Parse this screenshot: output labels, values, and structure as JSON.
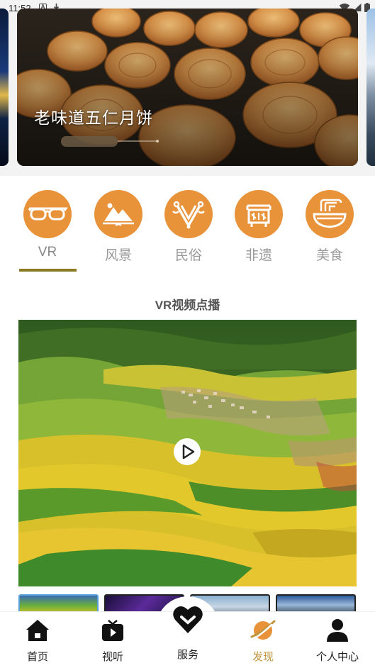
{
  "status_bar": {
    "time": "11:52",
    "icons": [
      "a-notification-icon",
      "download-icon",
      "wifi-icon",
      "cellular-icon",
      "battery-icon"
    ]
  },
  "banner": {
    "title": "老味道五仁月饼",
    "image": "mooncake-photo"
  },
  "categories": [
    {
      "label": "VR",
      "icon": "vr-glasses-icon",
      "active": true
    },
    {
      "label": "风景",
      "icon": "mountain-icon",
      "active": false
    },
    {
      "label": "民俗",
      "icon": "folk-ornament-icon",
      "active": false
    },
    {
      "label": "非遗",
      "icon": "heritage-icon",
      "active": false
    },
    {
      "label": "美食",
      "icon": "food-bowl-icon",
      "active": false
    }
  ],
  "section": {
    "title": "VR视频点播"
  },
  "video": {
    "image": "rapeseed-field-landscape",
    "play_icon": "play-icon"
  },
  "thumbnails": [
    "thumb-landscape",
    "thumb-night-lights",
    "thumb-city-towers",
    "thumb-skyline"
  ],
  "bottom_nav": [
    {
      "label": "首页",
      "icon": "home-icon",
      "active": false
    },
    {
      "label": "视听",
      "icon": "tv-play-icon",
      "active": false
    },
    {
      "label": "服务",
      "icon": "heart-icon",
      "active": false
    },
    {
      "label": "发现",
      "icon": "planet-icon",
      "active": true
    },
    {
      "label": "个人中心",
      "icon": "user-icon",
      "active": false
    }
  ],
  "colors": {
    "accent_orange": "#e8923a",
    "active_nav": "#c0953f",
    "underline": "#8d7a25",
    "inactive_text": "#999999"
  }
}
